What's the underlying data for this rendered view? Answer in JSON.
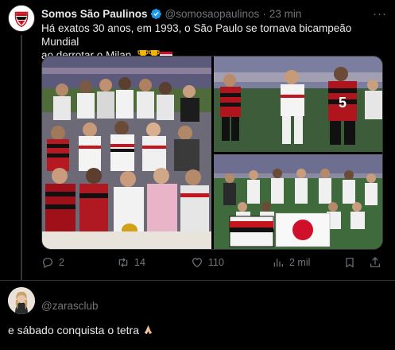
{
  "tweet": {
    "author_name": "Somos São Paulinos",
    "handle": "@somosaopaulinos",
    "separator": "·",
    "time": "23 min",
    "more_label": "···",
    "text_line1": "Há exatos 30 anos, em 1993, o São Paulo se tornava bicampeão Mundial",
    "text_line2": "ao derrotar o Milan.",
    "trailing_emojis": [
      "trophy-emoji",
      "trophy-emoji",
      "japan-flag-emoji"
    ],
    "media": [
      {
        "name": "team-photo",
        "description": "team-photo"
      },
      {
        "name": "match-action-photo",
        "description": "match-action-photo"
      },
      {
        "name": "team-lineup-photo",
        "description": "team-lineup-photo"
      }
    ],
    "actions": {
      "replies": "2",
      "reposts": "14",
      "likes": "110",
      "views": "2 mil"
    },
    "icons": {
      "reply": "reply-icon",
      "repost": "repost-icon",
      "like": "heart-icon",
      "views": "views-icon",
      "bookmark": "bookmark-icon",
      "share": "share-icon",
      "verified": "verified-badge-icon"
    }
  },
  "reply": {
    "handle": "@zarasclub",
    "text": "e sábado conquista o tetra",
    "emoji": "praying-hands-emoji"
  },
  "colors": {
    "background": "#000000",
    "text_primary": "#e7e9ea",
    "text_secondary": "#71767b",
    "verified": "#1d9bf0",
    "border": "#2f3336"
  }
}
